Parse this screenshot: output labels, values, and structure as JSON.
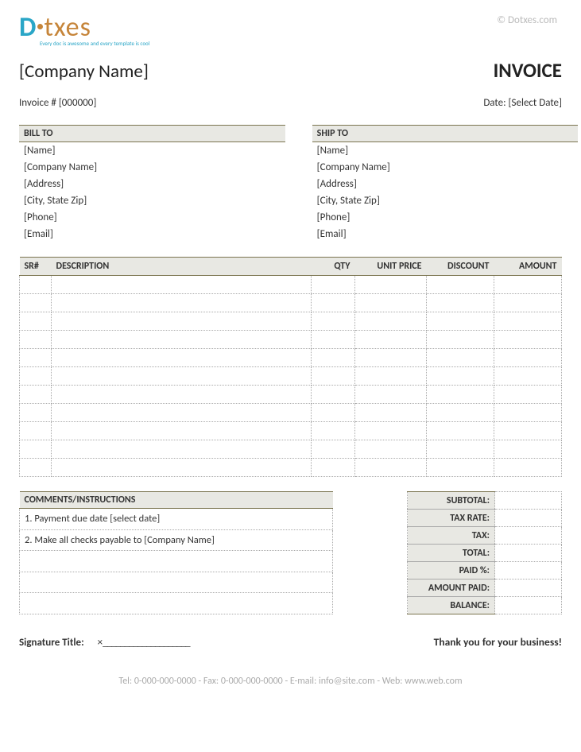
{
  "watermark": "© Dotxes.com",
  "logo": {
    "brand_d": "D",
    "brand_rest": "txes",
    "tagline": "Every doc is awesome and every template is cool"
  },
  "header": {
    "company_name": "[Company Name]",
    "invoice_title": "INVOICE",
    "invoice_no_label": "Invoice #",
    "invoice_no_value": "[000000]",
    "date_label": "Date:",
    "date_value": "[Select Date]"
  },
  "bill_to": {
    "title": "BILL TO",
    "name": "[Name]",
    "company": "[Company Name]",
    "address": "[Address]",
    "city": "[City, State Zip]",
    "phone": "[Phone]",
    "email": "[Email]"
  },
  "ship_to": {
    "title": "SHIP TO",
    "name": "[Name]",
    "company": "[Company Name]",
    "address": "[Address]",
    "city": "[City, State Zip]",
    "phone": "[Phone]",
    "email": "[Email]"
  },
  "items_header": {
    "sr": "SR#",
    "desc": "DESCRIPTION",
    "qty": "QTY",
    "unit_price": "UNIT PRICE",
    "discount": "DISCOUNT",
    "amount": "AMOUNT"
  },
  "comments": {
    "title": "COMMENTS/INSTRUCTIONS",
    "lines": [
      "1. Payment due date [select date]",
      "2. Make all checks payable to [Company Name]",
      "",
      "",
      ""
    ]
  },
  "summary": {
    "subtotal": "SUBTOTAL:",
    "tax_rate": "TAX RATE:",
    "tax": "TAX:",
    "total": "TOTAL:",
    "paid_pct": "PAID %:",
    "amount_paid": "AMOUNT PAID:",
    "balance": "BALANCE:"
  },
  "signature": {
    "label": "Signature Title:",
    "x": "×",
    "line": "____________________"
  },
  "thanks": "Thank you for your business!",
  "footer": "Tel: 0-000-000-0000  - Fax: 0-000-000-0000 - E-mail: info@site.com - Web: www.web.com"
}
